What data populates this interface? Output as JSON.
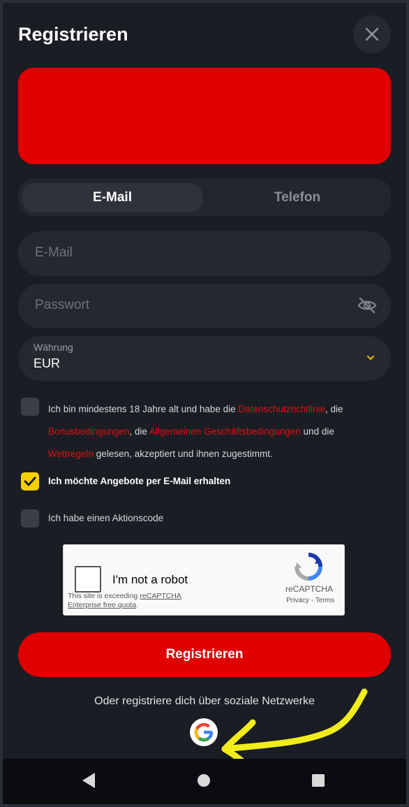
{
  "header": {
    "title": "Registrieren",
    "close_icon": "close-icon"
  },
  "tabs": [
    {
      "label": "E-Mail",
      "active": true
    },
    {
      "label": "Telefon",
      "active": false
    }
  ],
  "form": {
    "email_placeholder": "E-Mail",
    "password_placeholder": "Passwort",
    "password_icon": "eye-off-icon",
    "currency": {
      "label": "Währung",
      "value": "EUR",
      "icon": "chevron-down-icon"
    }
  },
  "consent": {
    "t1": "Ich bin mindestens 18 Jahre alt und habe die ",
    "l1": "Datenschutzrichtlinie",
    "t2": ", die ",
    "l2": "Bonusbedingungen",
    "t3": ", die ",
    "l3": "Allgemeinen Geschäftsbedingungen",
    "t4": " und die ",
    "l4": "Wettregeln",
    "t5": " gelesen, akzeptiert und ihnen zugestimmt.",
    "checked": false
  },
  "offers": {
    "label": "Ich möchte Angebote per E-Mail erhalten",
    "checked": true
  },
  "promo": {
    "label": "Ich habe einen Aktionscode",
    "checked": false
  },
  "captcha": {
    "label": "I'm not a robot",
    "quota_text": "This site is exceeding ",
    "quota_link": "reCAPTCHA Enterprise free quota",
    "quota_end": ".",
    "brand": "reCAPTCHA",
    "privacy": "Privacy",
    "separator": " - ",
    "terms": "Terms"
  },
  "submit_label": "Registrieren",
  "social": {
    "label": "Oder registriere dich über soziale Netzwerke",
    "icon": "google-icon"
  },
  "colors": {
    "accent": "#e00000",
    "checkbox_checked": "#f5d000",
    "background": "#1b1d24",
    "annotation": "#f2ec1c"
  },
  "navbar": {
    "icons": [
      "back-icon",
      "home-icon",
      "recents-icon"
    ]
  }
}
